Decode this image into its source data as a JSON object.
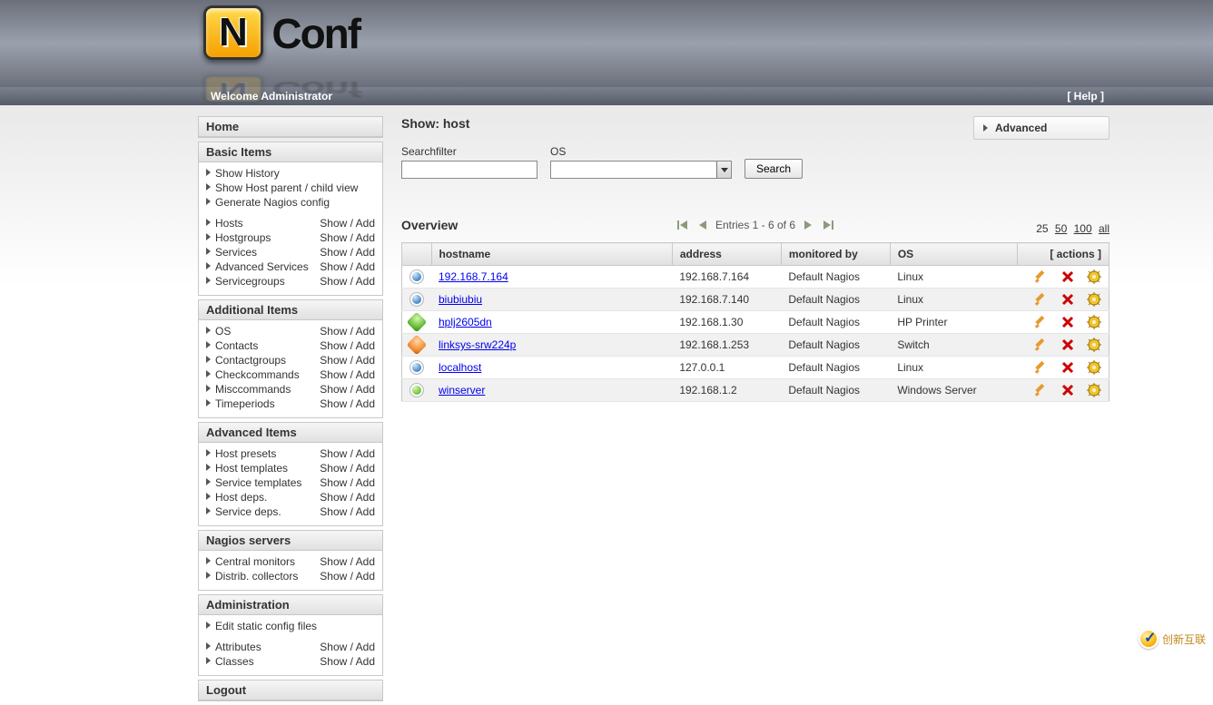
{
  "app": {
    "logo_letter": "N",
    "logo_text": "Conf"
  },
  "welcome": {
    "text": "Welcome Administrator",
    "help": "[ Help ]"
  },
  "sidebar": {
    "home": "Home",
    "basic": {
      "title": "Basic Items",
      "history": "Show History",
      "parent": "Show Host parent / child view",
      "generate": "Generate Nagios config",
      "items": [
        {
          "label": "Hosts"
        },
        {
          "label": "Hostgroups"
        },
        {
          "label": "Services"
        },
        {
          "label": "Advanced Services"
        },
        {
          "label": "Servicegroups"
        }
      ]
    },
    "additional": {
      "title": "Additional Items",
      "items": [
        {
          "label": "OS"
        },
        {
          "label": "Contacts"
        },
        {
          "label": "Contactgroups"
        },
        {
          "label": "Checkcommands"
        },
        {
          "label": "Misccommands"
        },
        {
          "label": "Timeperiods"
        }
      ]
    },
    "advanced": {
      "title": "Advanced Items",
      "items": [
        {
          "label": "Host presets"
        },
        {
          "label": "Host templates"
        },
        {
          "label": "Service templates"
        },
        {
          "label": "Host deps."
        },
        {
          "label": "Service deps."
        }
      ]
    },
    "nagios": {
      "title": "Nagios servers",
      "items": [
        {
          "label": "Central monitors"
        },
        {
          "label": "Distrib. collectors"
        }
      ]
    },
    "admin": {
      "title": "Administration",
      "edit": "Edit static config files",
      "items": [
        {
          "label": "Attributes"
        },
        {
          "label": "Classes"
        }
      ]
    },
    "logout": "Logout",
    "show_add": {
      "show": "Show",
      "sep": " / ",
      "add": "Add"
    }
  },
  "main": {
    "title": "Show: host",
    "advanced_btn": "Advanced",
    "filter": {
      "search_label": "Searchfilter",
      "search_value": "",
      "os_label": "OS",
      "os_value": "",
      "search_btn": "Search"
    },
    "overview": {
      "title": "Overview",
      "entries": "Entries 1 - 6 of 6",
      "page_sizes": {
        "p25": "25",
        "p50": "50",
        "p100": "100",
        "all": "all"
      },
      "columns": {
        "hostname": "hostname",
        "address": "address",
        "monitored": "monitored by",
        "os": "OS",
        "actions": "[ actions ]"
      },
      "rows": [
        {
          "icon": "blue",
          "hostname": "192.168.7.164",
          "address": "192.168.7.164",
          "monitored": "Default Nagios",
          "os": "Linux"
        },
        {
          "icon": "blue",
          "hostname": "biubiubiu",
          "address": "192.168.7.140",
          "monitored": "Default Nagios",
          "os": "Linux"
        },
        {
          "icon": "green",
          "hostname": "hplj2605dn",
          "address": "192.168.1.30",
          "monitored": "Default Nagios",
          "os": "HP Printer"
        },
        {
          "icon": "orange",
          "hostname": "linksys-srw224p",
          "address": "192.168.1.253",
          "monitored": "Default Nagios",
          "os": "Switch"
        },
        {
          "icon": "blue",
          "hostname": "localhost",
          "address": "127.0.0.1",
          "monitored": "Default Nagios",
          "os": "Linux"
        },
        {
          "icon": "greenr",
          "hostname": "winserver",
          "address": "192.168.1.2",
          "monitored": "Default Nagios",
          "os": "Windows Server"
        }
      ]
    }
  },
  "watermark": "创新互联"
}
